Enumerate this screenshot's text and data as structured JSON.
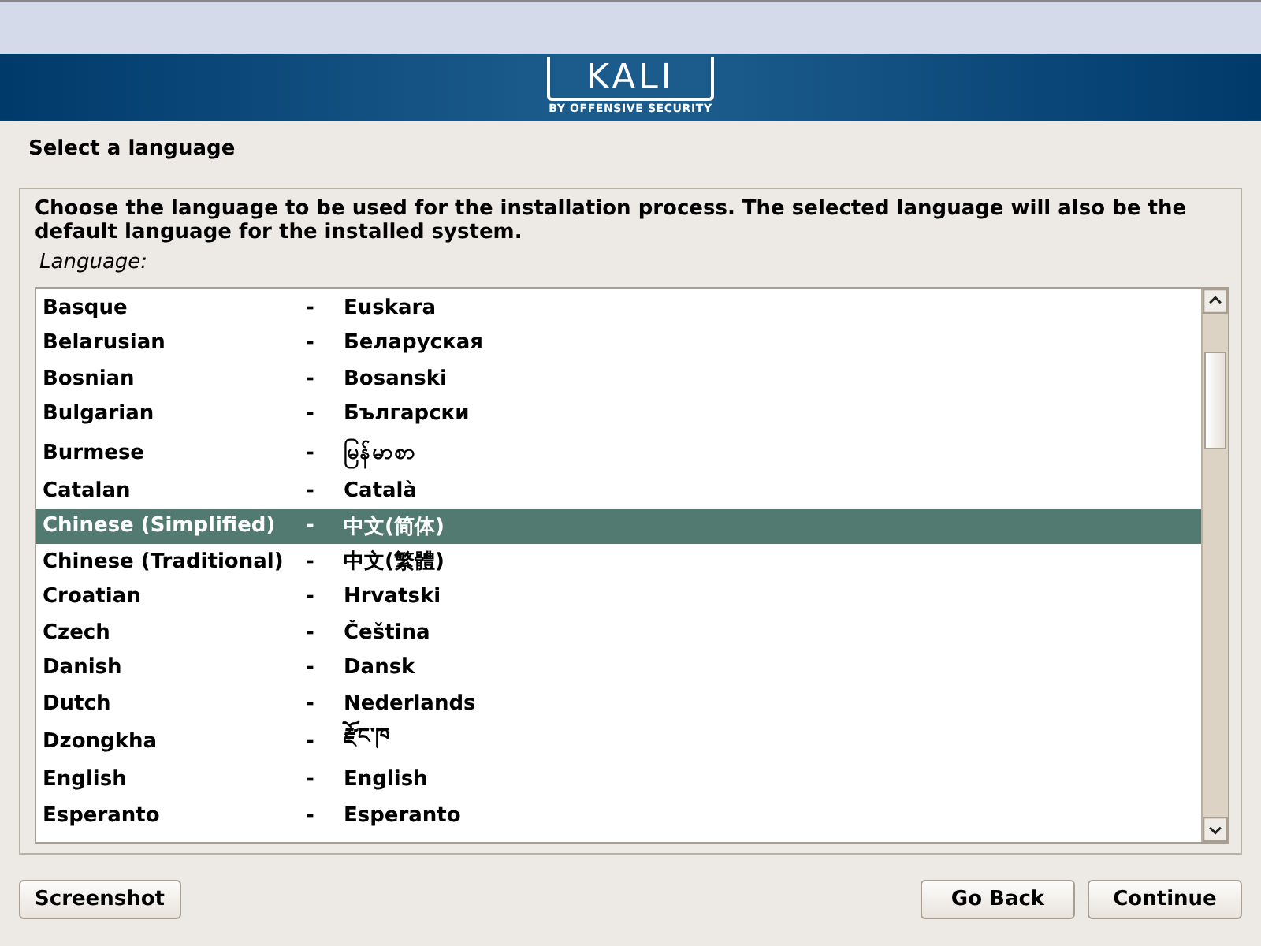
{
  "banner": {
    "logo": "KALI",
    "tagline": "BY OFFENSIVE SECURITY"
  },
  "step_title": "Select a language",
  "description": "Choose the language to be used for the installation process. The selected language will also be the default language for the installed system.",
  "list_label": "Language:",
  "languages": [
    {
      "name": "Basque",
      "native": "Euskara",
      "selected": false
    },
    {
      "name": "Belarusian",
      "native": "Беларуская",
      "selected": false
    },
    {
      "name": "Bosnian",
      "native": "Bosanski",
      "selected": false
    },
    {
      "name": "Bulgarian",
      "native": "Български",
      "selected": false
    },
    {
      "name": "Burmese",
      "native": "မြန်မာစာ",
      "selected": false
    },
    {
      "name": "Catalan",
      "native": "Català",
      "selected": false
    },
    {
      "name": "Chinese (Simplified)",
      "native": "中文(简体)",
      "selected": true
    },
    {
      "name": "Chinese (Traditional)",
      "native": "中文(繁體)",
      "selected": false
    },
    {
      "name": "Croatian",
      "native": "Hrvatski",
      "selected": false
    },
    {
      "name": "Czech",
      "native": "Čeština",
      "selected": false
    },
    {
      "name": "Danish",
      "native": "Dansk",
      "selected": false
    },
    {
      "name": "Dutch",
      "native": "Nederlands",
      "selected": false
    },
    {
      "name": "Dzongkha",
      "native": "རྫོང་ཁ",
      "selected": false
    },
    {
      "name": "English",
      "native": "English",
      "selected": false
    },
    {
      "name": "Esperanto",
      "native": "Esperanto",
      "selected": false
    }
  ],
  "separator": "-",
  "buttons": {
    "left": [
      "Screenshot"
    ],
    "right": [
      "Go Back",
      "Continue"
    ]
  }
}
